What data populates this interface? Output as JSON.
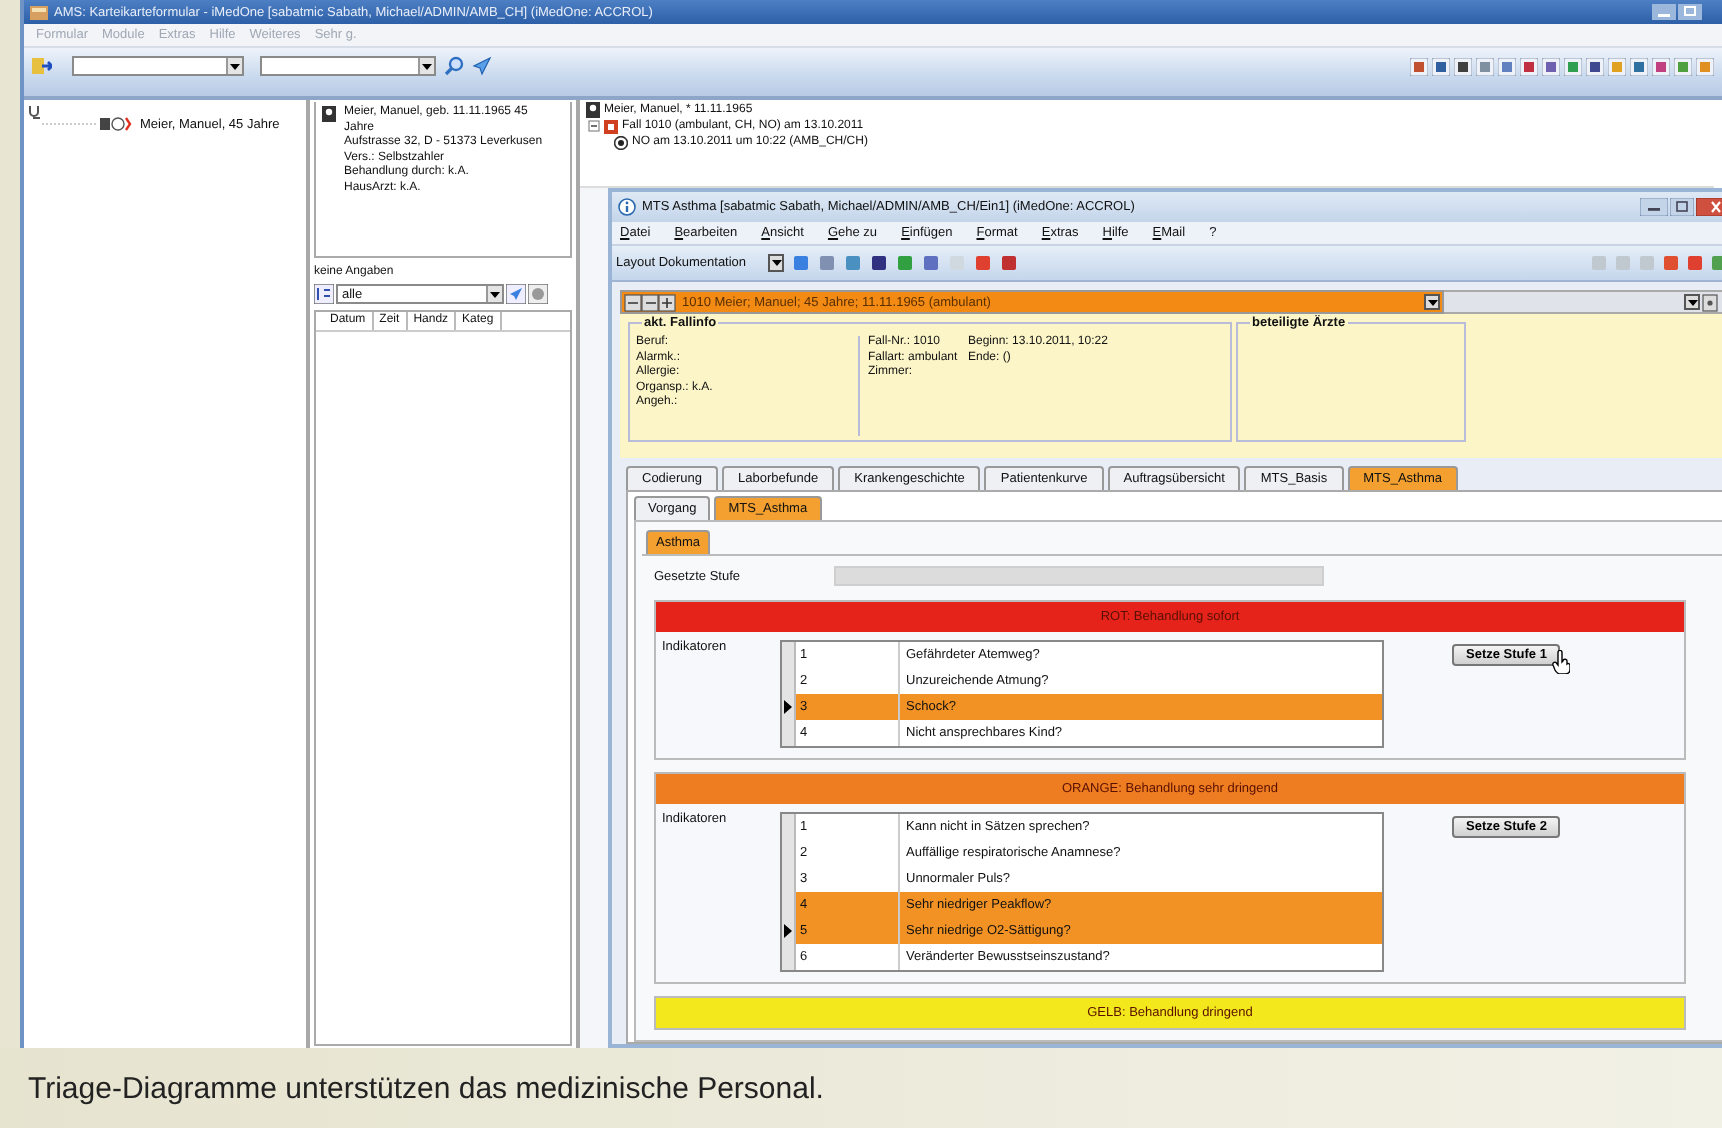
{
  "window": {
    "title": "AMS: Karteikarteformular - iMedOne [sabatmic Sabath, Michael/ADMIN/AMB_CH] (iMedOne: ACCROL)"
  },
  "menu": [
    {
      "label": "Formular",
      "disabled": true
    },
    {
      "label": "Module",
      "disabled": true
    },
    {
      "label": "Extras",
      "disabled": true
    },
    {
      "label": "Hilfe",
      "disabled": true
    },
    {
      "label": "Weiteres",
      "disabled": true
    },
    {
      "label": "Sehr g.",
      "disabled": true
    }
  ],
  "patient_tree": {
    "items": [
      {
        "label": "Meier, Manuel, 45 Jahre"
      }
    ]
  },
  "patient_card": {
    "lines": [
      "Meier, Manuel, geb. 11.11.1965 45 Jahre",
      "Aufstrasse 32, D - 51373 Leverkusen",
      "Vers.: Selbstzahler",
      "Behandlung durch: k.A.",
      "HausArzt: k.A."
    ],
    "status": "keine Angaben",
    "filter": "alle",
    "columns": [
      "Datum",
      "Zeit",
      "Handz",
      "Kateg"
    ]
  },
  "case_tree": [
    {
      "label": "Meier, Manuel, * 11.11.1965",
      "children": [
        {
          "label": "Fall 1010 (ambulant, CH, NO) am 13.10.2011",
          "children": [
            {
              "label": "NO am 13.10.2011 um 10:22 (AMB_CH/CH)"
            }
          ]
        }
      ]
    }
  ],
  "form_window": {
    "title": "MTS Asthma [sabatmic Sabath, Michael/ADMIN/AMB_CH/Ein1] (iMedOne: ACCROL)",
    "menu": [
      "Datei",
      "Bearbeiten",
      "Ansicht",
      "Gehe zu",
      "Einfügen",
      "Format",
      "Extras",
      "Hilfe",
      "EMail",
      "?"
    ],
    "layout_label": "Layout Dokumentation",
    "header": "1010 Meier; Manuel; 45 Jahre; 11.11.1965 (ambulant)",
    "fallinfo": {
      "title": "akt. Fallinfo",
      "col_1": [
        "Beruf:",
        "Alarmk.:",
        "Allergie:",
        "Organsp.: k.A.",
        "Angeh.:"
      ],
      "col_2": [
        "Fall-Nr.: 1010",
        "Fallart: ambulant",
        "Zimmer:"
      ],
      "col_3": [
        "Beginn: 13.10.2011, 10:22",
        "Ende: ()"
      ]
    },
    "doctors": {
      "title": "beteiligte Ärzte"
    },
    "tabs": [
      {
        "label": "Codierung",
        "selected": false
      },
      {
        "label": "Laborbefunde",
        "selected": false
      },
      {
        "label": "Krankengeschichte",
        "selected": false
      },
      {
        "label": "Patientenkurve",
        "selected": false
      },
      {
        "label": "Auftragsübersicht",
        "selected": false
      },
      {
        "label": "MTS_Basis",
        "selected": false
      },
      {
        "label": "MTS_Asthma",
        "selected": true
      }
    ],
    "subtabs": [
      {
        "label": "Vorgang",
        "selected": false
      },
      {
        "label": "MTS_Asthma",
        "selected": true
      }
    ],
    "inner_tabs": [
      {
        "label": "Asthma",
        "selected": true
      }
    ],
    "set_level_label": "Gesetzte Stufe",
    "sections": [
      {
        "title": "ROT: Behandlung sofort",
        "color": "#e5231b",
        "label": "Indikatoren",
        "button": "Setze Stufe 1",
        "rows": [
          {
            "number": "1",
            "text": "Gefährdeter Atemweg?",
            "selected": false,
            "current": false
          },
          {
            "number": "2",
            "text": "Unzureichende Atmung?",
            "selected": false,
            "current": false
          },
          {
            "number": "3",
            "text": "Schock?",
            "selected": true,
            "current": true
          },
          {
            "number": "4",
            "text": "Nicht ansprechbares Kind?",
            "selected": false,
            "current": false
          }
        ]
      },
      {
        "title": "ORANGE: Behandlung sehr dringend",
        "color": "#ee7d22",
        "label": "Indikatoren",
        "button": "Setze Stufe 2",
        "rows": [
          {
            "number": "1",
            "text": "Kann nicht in Sätzen sprechen?",
            "selected": false,
            "current": false
          },
          {
            "number": "2",
            "text": "Auffällige respiratorische Anamnese?",
            "selected": false,
            "current": false
          },
          {
            "number": "3",
            "text": "Unnormaler Puls?",
            "selected": false,
            "current": false
          },
          {
            "number": "4",
            "text": "Sehr niedriger Peakflow?",
            "selected": true,
            "current": false
          },
          {
            "number": "5",
            "text": "Sehr niedrige O2-Sättigung?",
            "selected": true,
            "current": true
          },
          {
            "number": "6",
            "text": "Veränderter Bewusstseinszustand?",
            "selected": false,
            "current": false
          }
        ]
      },
      {
        "title": "GELB: Behandlung dringend",
        "color": "#f2e81c"
      }
    ]
  },
  "caption": "Triage-Diagramme unterstützen das medizinische Personal."
}
